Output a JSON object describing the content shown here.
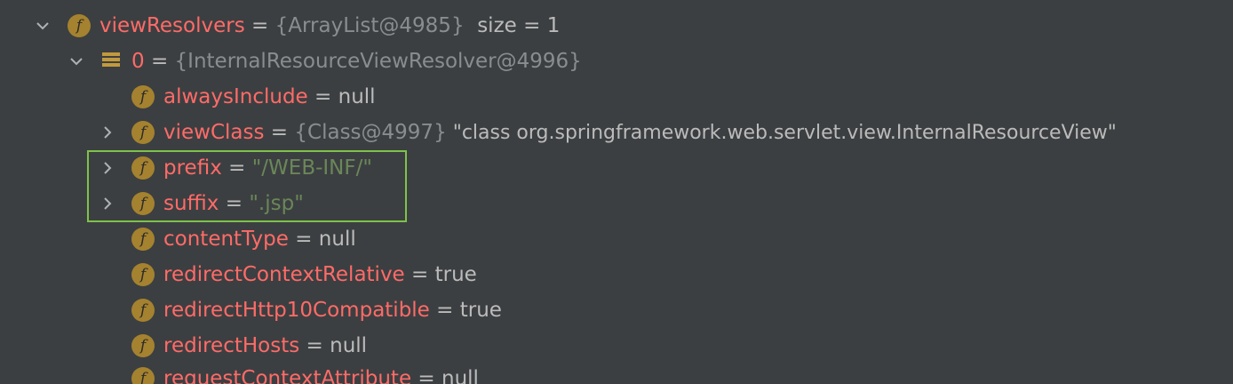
{
  "tree": {
    "rows": [
      {
        "id": "viewResolvers",
        "toggle": "expanded",
        "icon": "field-icon",
        "icon_glyph": "f",
        "name": "viewResolvers",
        "eq": " = ",
        "ref": "{ArrayList@4985}",
        "extra": "  size = 1"
      },
      {
        "id": "item0",
        "toggle": "expanded",
        "icon": "array-element-icon",
        "name": "0",
        "eq": " = ",
        "ref": "{InternalResourceViewResolver@4996}"
      },
      {
        "id": "alwaysInclude",
        "toggle": "none",
        "icon": "field-icon",
        "icon_glyph": "f",
        "name": "alwaysInclude",
        "eq": " = ",
        "value": "null"
      },
      {
        "id": "viewClass",
        "toggle": "collapsed",
        "icon": "field-icon",
        "icon_glyph": "f",
        "name": "viewClass",
        "eq": " = ",
        "ref": "{Class@4997}",
        "value": " \"class org.springframework.web.servlet.view.InternalResourceView\""
      },
      {
        "id": "prefix",
        "toggle": "collapsed",
        "icon": "field-icon",
        "icon_glyph": "f",
        "name": "prefix",
        "eq": " = ",
        "string_value": "\"/WEB-INF/\""
      },
      {
        "id": "suffix",
        "toggle": "collapsed",
        "icon": "field-icon",
        "icon_glyph": "f",
        "name": "suffix",
        "eq": " = ",
        "string_value": "\".jsp\""
      },
      {
        "id": "contentType",
        "toggle": "none",
        "icon": "field-icon",
        "icon_glyph": "f",
        "name": "contentType",
        "eq": " = ",
        "value": "null"
      },
      {
        "id": "redirectContextRelative",
        "toggle": "none",
        "icon": "field-icon",
        "icon_glyph": "f",
        "name": "redirectContextRelative",
        "eq": " = ",
        "value": "true"
      },
      {
        "id": "redirectHttp10Compatible",
        "toggle": "none",
        "icon": "field-icon",
        "icon_glyph": "f",
        "name": "redirectHttp10Compatible",
        "eq": " = ",
        "value": "true"
      },
      {
        "id": "redirectHosts",
        "toggle": "none",
        "icon": "field-icon",
        "icon_glyph": "f",
        "name": "redirectHosts",
        "eq": " = ",
        "value": "null"
      },
      {
        "id": "requestContextAttribute",
        "toggle": "none",
        "icon": "field-icon",
        "icon_glyph": "f",
        "name": "requestContextAttribute",
        "eq": " = ",
        "value": "null"
      }
    ]
  },
  "colors": {
    "background": "#3c3f41",
    "field_name": "#ff6b68",
    "string_value": "#6a8759",
    "reference": "#8a8d8f",
    "plain_text": "#bbbbbb",
    "highlight_border": "#7ec24a",
    "field_icon": "#a5822f"
  }
}
